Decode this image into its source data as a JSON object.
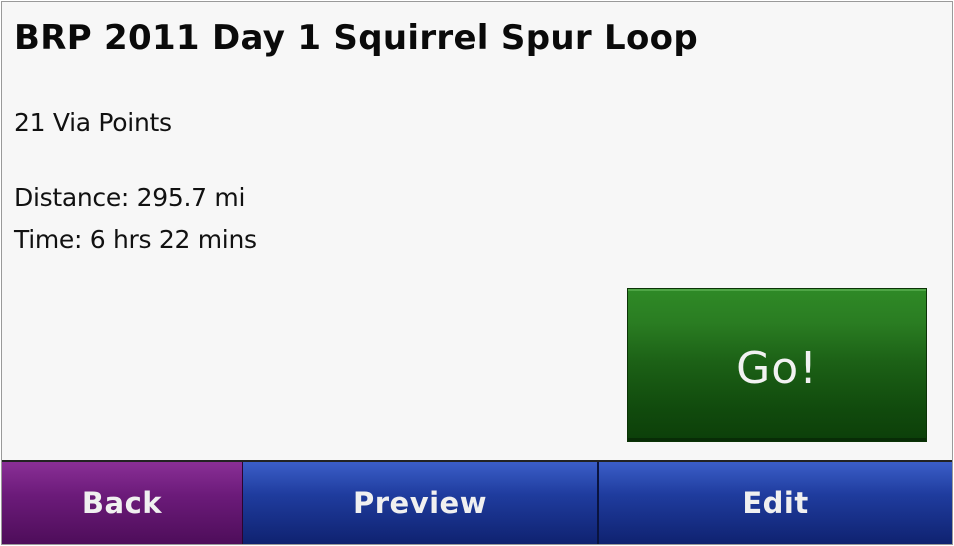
{
  "route": {
    "title": "BRP 2011 Day 1 Squirrel Spur Loop",
    "via_points": "21 Via Points",
    "distance": "Distance: 295.7 mi",
    "time": "Time: 6 hrs 22 mins"
  },
  "actions": {
    "go_label": "Go!"
  },
  "bottom_bar": {
    "back_label": "Back",
    "preview_label": "Preview",
    "edit_label": "Edit"
  },
  "colors": {
    "go_button": "#1c6116",
    "back_button": "#6c1b7a",
    "preview_button": "#1f3c9e",
    "edit_button": "#1f3c9e",
    "background": "#f7f7f7"
  }
}
